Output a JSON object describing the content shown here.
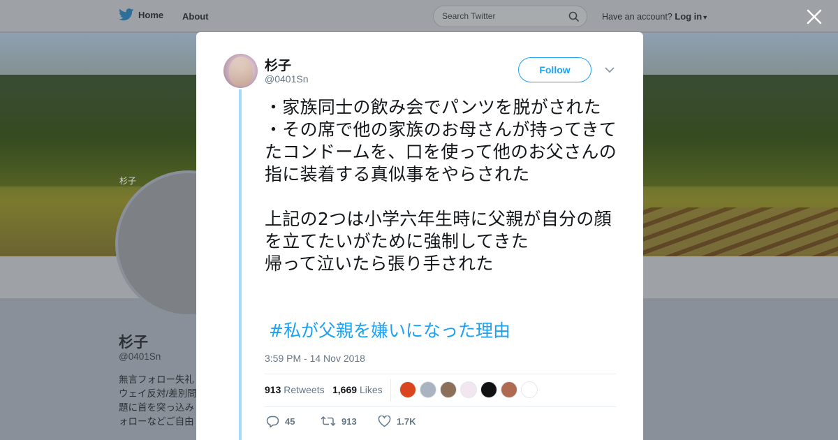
{
  "topbar": {
    "home_label": "Home",
    "about_label": "About",
    "search_placeholder": "Search Twitter",
    "account_prompt": "Have an account?",
    "login_label": "Log in"
  },
  "background_profile": {
    "avatar_alt": "杉子",
    "name": "杉子",
    "handle": "@0401Sn",
    "bio": "無言フォロー失礼\nウェイ反対/差別問\n題に首を突っ込み\nォローなどご自由"
  },
  "tweet": {
    "author_name": "杉子",
    "author_handle": "@0401Sn",
    "follow_label": "Follow",
    "text": "・家族同士の飲み会でパンツを脱がされた\n・その席で他の家族のお母さんが持ってきてたコンドームを、口を使って他のお父さんの指に装着する真似事をやらされた\n\n上記の2つは小学六年生時に父親が自分の顔を立てたいがために強制してきた\n帰って泣いたら張り手された",
    "hashtag": "#私が父親を嫌いになった理由",
    "timestamp": "3:59 PM - 14 Nov 2018",
    "retweets_count": "913",
    "retweets_label": "Retweets",
    "likes_count": "1,669",
    "likes_label": "Likes",
    "likers": [
      {
        "color": "#d9451f"
      },
      {
        "color": "#aab4c0"
      },
      {
        "color": "#8c6f5a"
      },
      {
        "color": "#f2e6ef"
      },
      {
        "color": "#111111"
      },
      {
        "color": "#b06a4f"
      },
      {
        "color": "#ffffff"
      }
    ],
    "actions": {
      "reply_count": "45",
      "retweet_count": "913",
      "like_count": "1.7K"
    }
  },
  "colors": {
    "accent": "#1da1f2",
    "thread_line": "#a4d9f9",
    "muted": "#657786"
  }
}
